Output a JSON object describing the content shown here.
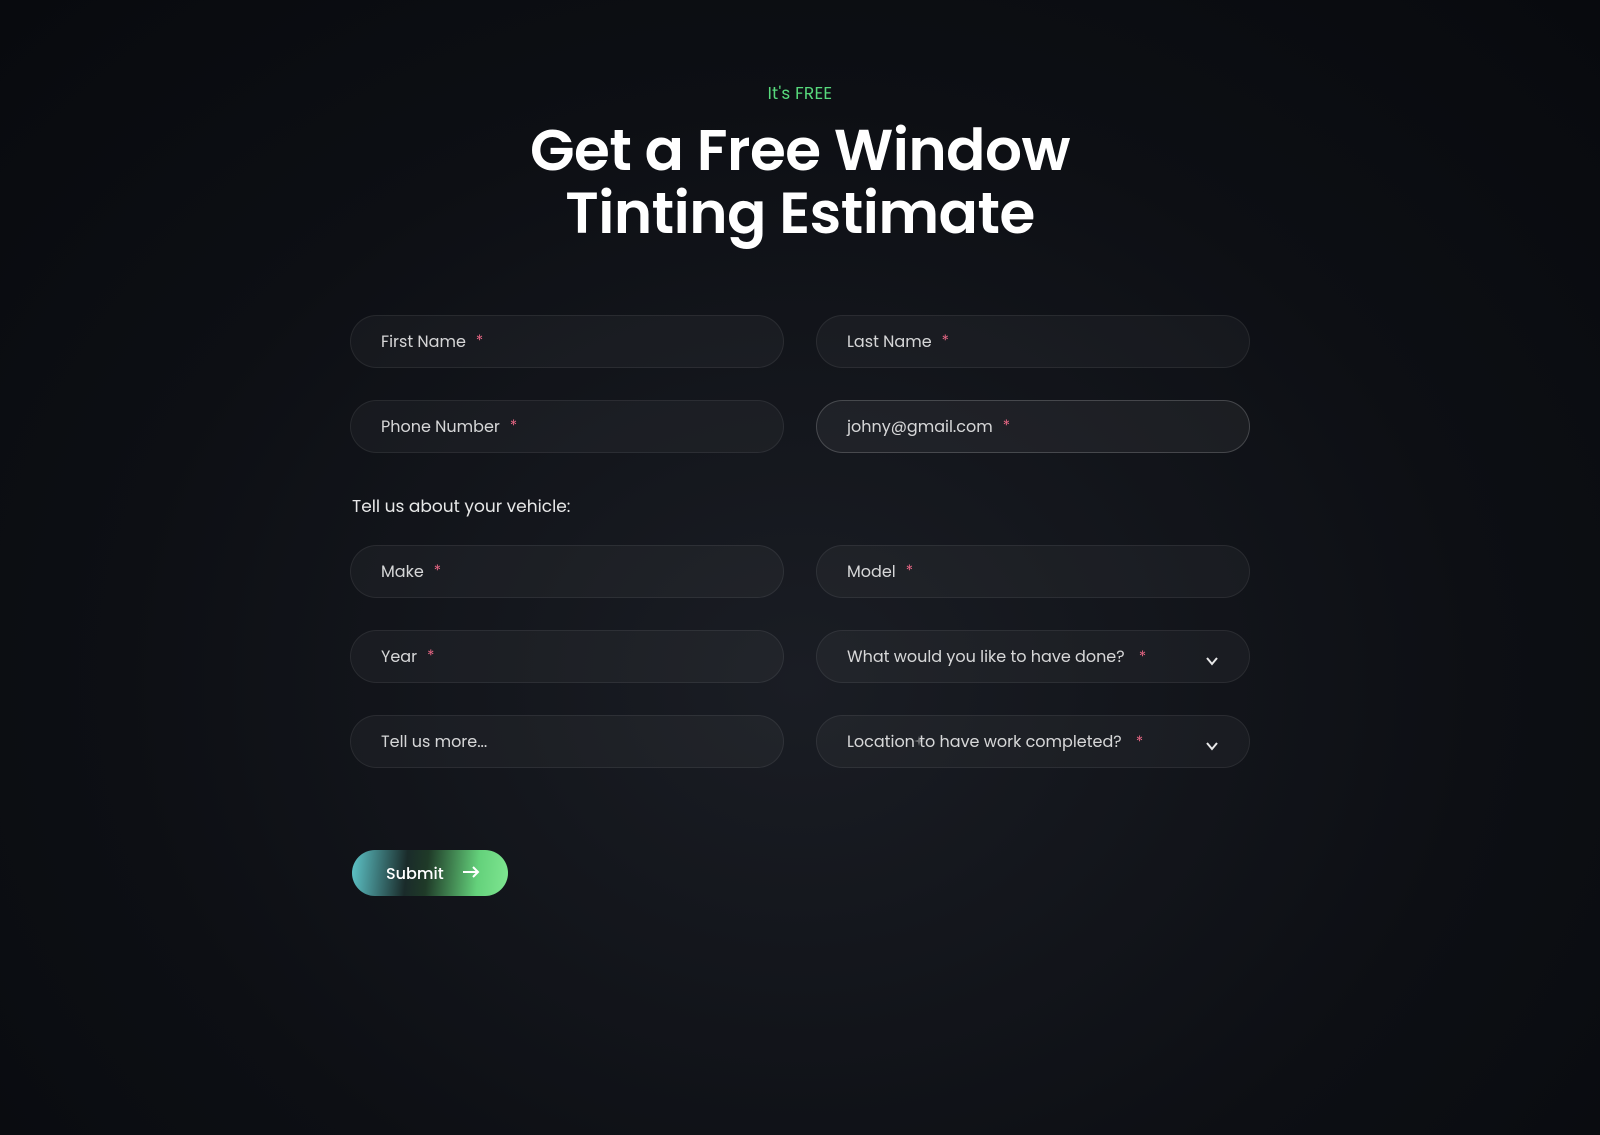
{
  "header": {
    "eyebrow": "It's FREE",
    "headline": "Get a Free Window Tinting Estimate"
  },
  "form": {
    "firstName": {
      "placeholder": "First Name",
      "required": "*"
    },
    "lastName": {
      "placeholder": "Last Name",
      "required": "*"
    },
    "phone": {
      "placeholder": "Phone Number",
      "required": "*"
    },
    "email": {
      "placeholder": "johny@gmail.com",
      "required": "*"
    },
    "sectionLabel": "Tell us about your vehicle:",
    "make": {
      "placeholder": "Make",
      "required": "*"
    },
    "model": {
      "placeholder": "Model",
      "required": "*"
    },
    "year": {
      "placeholder": "Year",
      "required": "*"
    },
    "service": {
      "placeholder": "What would you like to have done?",
      "required": "*"
    },
    "notes": {
      "placeholder": "Tell us more..."
    },
    "location": {
      "placeholder": "Location to have work completed?",
      "required": "*"
    },
    "submit": "Submit"
  }
}
